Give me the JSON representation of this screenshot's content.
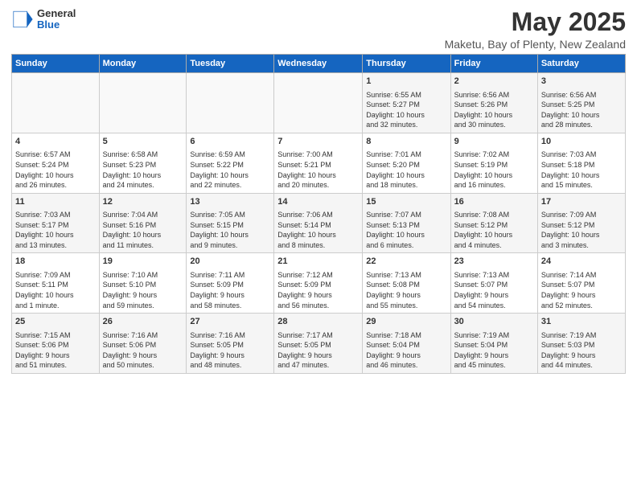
{
  "header": {
    "logo_general": "General",
    "logo_blue": "Blue",
    "main_title": "May 2025",
    "subtitle": "Maketu, Bay of Plenty, New Zealand"
  },
  "days_of_week": [
    "Sunday",
    "Monday",
    "Tuesday",
    "Wednesday",
    "Thursday",
    "Friday",
    "Saturday"
  ],
  "weeks": [
    [
      {
        "day": "",
        "info": ""
      },
      {
        "day": "",
        "info": ""
      },
      {
        "day": "",
        "info": ""
      },
      {
        "day": "",
        "info": ""
      },
      {
        "day": "1",
        "info": "Sunrise: 6:55 AM\nSunset: 5:27 PM\nDaylight: 10 hours\nand 32 minutes."
      },
      {
        "day": "2",
        "info": "Sunrise: 6:56 AM\nSunset: 5:26 PM\nDaylight: 10 hours\nand 30 minutes."
      },
      {
        "day": "3",
        "info": "Sunrise: 6:56 AM\nSunset: 5:25 PM\nDaylight: 10 hours\nand 28 minutes."
      }
    ],
    [
      {
        "day": "4",
        "info": "Sunrise: 6:57 AM\nSunset: 5:24 PM\nDaylight: 10 hours\nand 26 minutes."
      },
      {
        "day": "5",
        "info": "Sunrise: 6:58 AM\nSunset: 5:23 PM\nDaylight: 10 hours\nand 24 minutes."
      },
      {
        "day": "6",
        "info": "Sunrise: 6:59 AM\nSunset: 5:22 PM\nDaylight: 10 hours\nand 22 minutes."
      },
      {
        "day": "7",
        "info": "Sunrise: 7:00 AM\nSunset: 5:21 PM\nDaylight: 10 hours\nand 20 minutes."
      },
      {
        "day": "8",
        "info": "Sunrise: 7:01 AM\nSunset: 5:20 PM\nDaylight: 10 hours\nand 18 minutes."
      },
      {
        "day": "9",
        "info": "Sunrise: 7:02 AM\nSunset: 5:19 PM\nDaylight: 10 hours\nand 16 minutes."
      },
      {
        "day": "10",
        "info": "Sunrise: 7:03 AM\nSunset: 5:18 PM\nDaylight: 10 hours\nand 15 minutes."
      }
    ],
    [
      {
        "day": "11",
        "info": "Sunrise: 7:03 AM\nSunset: 5:17 PM\nDaylight: 10 hours\nand 13 minutes."
      },
      {
        "day": "12",
        "info": "Sunrise: 7:04 AM\nSunset: 5:16 PM\nDaylight: 10 hours\nand 11 minutes."
      },
      {
        "day": "13",
        "info": "Sunrise: 7:05 AM\nSunset: 5:15 PM\nDaylight: 10 hours\nand 9 minutes."
      },
      {
        "day": "14",
        "info": "Sunrise: 7:06 AM\nSunset: 5:14 PM\nDaylight: 10 hours\nand 8 minutes."
      },
      {
        "day": "15",
        "info": "Sunrise: 7:07 AM\nSunset: 5:13 PM\nDaylight: 10 hours\nand 6 minutes."
      },
      {
        "day": "16",
        "info": "Sunrise: 7:08 AM\nSunset: 5:12 PM\nDaylight: 10 hours\nand 4 minutes."
      },
      {
        "day": "17",
        "info": "Sunrise: 7:09 AM\nSunset: 5:12 PM\nDaylight: 10 hours\nand 3 minutes."
      }
    ],
    [
      {
        "day": "18",
        "info": "Sunrise: 7:09 AM\nSunset: 5:11 PM\nDaylight: 10 hours\nand 1 minute."
      },
      {
        "day": "19",
        "info": "Sunrise: 7:10 AM\nSunset: 5:10 PM\nDaylight: 9 hours\nand 59 minutes."
      },
      {
        "day": "20",
        "info": "Sunrise: 7:11 AM\nSunset: 5:09 PM\nDaylight: 9 hours\nand 58 minutes."
      },
      {
        "day": "21",
        "info": "Sunrise: 7:12 AM\nSunset: 5:09 PM\nDaylight: 9 hours\nand 56 minutes."
      },
      {
        "day": "22",
        "info": "Sunrise: 7:13 AM\nSunset: 5:08 PM\nDaylight: 9 hours\nand 55 minutes."
      },
      {
        "day": "23",
        "info": "Sunrise: 7:13 AM\nSunset: 5:07 PM\nDaylight: 9 hours\nand 54 minutes."
      },
      {
        "day": "24",
        "info": "Sunrise: 7:14 AM\nSunset: 5:07 PM\nDaylight: 9 hours\nand 52 minutes."
      }
    ],
    [
      {
        "day": "25",
        "info": "Sunrise: 7:15 AM\nSunset: 5:06 PM\nDaylight: 9 hours\nand 51 minutes."
      },
      {
        "day": "26",
        "info": "Sunrise: 7:16 AM\nSunset: 5:06 PM\nDaylight: 9 hours\nand 50 minutes."
      },
      {
        "day": "27",
        "info": "Sunrise: 7:16 AM\nSunset: 5:05 PM\nDaylight: 9 hours\nand 48 minutes."
      },
      {
        "day": "28",
        "info": "Sunrise: 7:17 AM\nSunset: 5:05 PM\nDaylight: 9 hours\nand 47 minutes."
      },
      {
        "day": "29",
        "info": "Sunrise: 7:18 AM\nSunset: 5:04 PM\nDaylight: 9 hours\nand 46 minutes."
      },
      {
        "day": "30",
        "info": "Sunrise: 7:19 AM\nSunset: 5:04 PM\nDaylight: 9 hours\nand 45 minutes."
      },
      {
        "day": "31",
        "info": "Sunrise: 7:19 AM\nSunset: 5:03 PM\nDaylight: 9 hours\nand 44 minutes."
      }
    ]
  ]
}
